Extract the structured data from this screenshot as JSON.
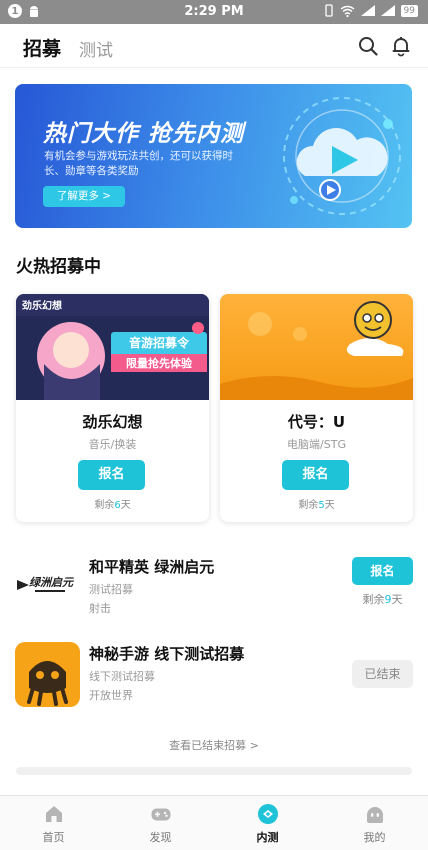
{
  "status_bar": {
    "badge": "1",
    "time": "2:29 PM",
    "battery": "99"
  },
  "header": {
    "tab_active": "招募",
    "tab_inactive": "测试",
    "icons": [
      "search-icon",
      "bell-icon"
    ]
  },
  "banner": {
    "title": "热门大作 抢先内测",
    "subtitle": "有机会参与游戏玩法共创，还可以获得时长、勋章等各类奖励",
    "button": "了解更多 >"
  },
  "section_title": "火热招募中",
  "cards": [
    {
      "name": "劲乐幻想",
      "tags": "音乐/换装",
      "button": "报名",
      "remain_prefix": "剩余",
      "remain_days": "6",
      "remain_suffix": "天",
      "art_text": [
        "劲乐幻想",
        "音游招募令",
        "限量抢先体验"
      ]
    },
    {
      "name": "代号：U",
      "tags": "电脑端/STG",
      "button": "报名",
      "remain_prefix": "剩余",
      "remain_days": "5",
      "remain_suffix": "天"
    }
  ],
  "rows": [
    {
      "title": "和平精英 绿洲启元",
      "sub": "测试招募",
      "sub2": "射击",
      "button": "报名",
      "remain_prefix": "剩余",
      "remain_days": "9",
      "remain_suffix": "天",
      "logo_text": "绿洲启元"
    },
    {
      "title": "神秘手游 线下测试招募",
      "sub": "线下测试招募",
      "sub2": "开放世界",
      "button": "已结束"
    }
  ],
  "more_link": "查看已结束招募  >",
  "bottom_nav": [
    {
      "label": "首页",
      "icon": "home-icon",
      "active": false
    },
    {
      "label": "发现",
      "icon": "gamepad-icon",
      "active": false
    },
    {
      "label": "内测",
      "icon": "beta-icon",
      "active": true
    },
    {
      "label": "我的",
      "icon": "profile-icon",
      "active": false
    }
  ],
  "colors": {
    "accent": "#1ec3d8",
    "status_bar": "#8c8c8c",
    "banner_start": "#2757d6",
    "banner_end": "#54c3f2"
  }
}
